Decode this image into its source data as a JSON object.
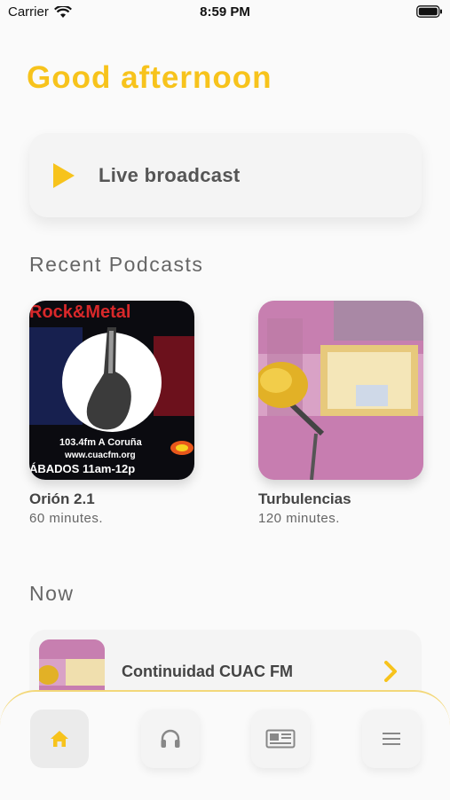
{
  "status_bar": {
    "carrier": "Carrier",
    "time": "8:59 PM"
  },
  "greeting": "Good afternoon",
  "live": {
    "label": "Live broadcast",
    "icon": "play-icon"
  },
  "recent": {
    "title": "Recent Podcasts",
    "items": [
      {
        "name": "Orión 2.1",
        "duration": "60 minutes.",
        "cover_text": {
          "headline": "Rock&Metal",
          "freq": "103.4fm A Coruña",
          "url": "www.cuacfm.org",
          "schedule": "ÁBADOS 11am-12p"
        }
      },
      {
        "name": "Turbulencias",
        "duration": "120 minutes."
      }
    ]
  },
  "now": {
    "title": "Now",
    "item": {
      "label": "Continuidad CUAC FM"
    }
  },
  "tabs": [
    {
      "icon": "home-icon",
      "active": true
    },
    {
      "icon": "headphones-icon",
      "active": false
    },
    {
      "icon": "news-icon",
      "active": false
    },
    {
      "icon": "menu-icon",
      "active": false
    }
  ],
  "colors": {
    "accent": "#f7c31c",
    "background": "#fafafa",
    "card": "#f4f4f4"
  }
}
